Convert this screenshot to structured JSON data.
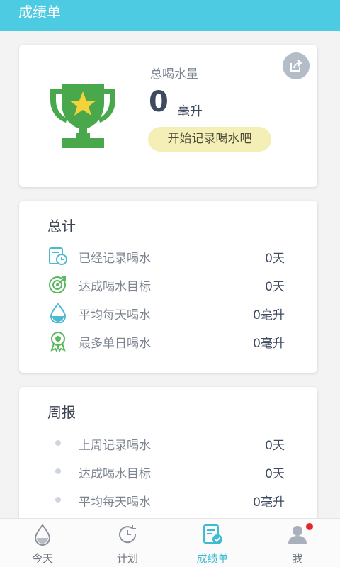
{
  "header": {
    "title": "成绩单"
  },
  "summary": {
    "total_label": "总喝水量",
    "total_value": "0",
    "total_unit": "毫升",
    "start_button": "开始记录喝水吧",
    "share_icon": "share-icon",
    "trophy_icon": "trophy-icon",
    "trophy_color": "#4aa84c",
    "star_color": "#f5d23a"
  },
  "totals": {
    "title": "总计",
    "rows": [
      {
        "icon": "calendar-clock-icon",
        "label": "已经记录喝水",
        "value": "0天"
      },
      {
        "icon": "target-icon",
        "label": "达成喝水目标",
        "value": "0天"
      },
      {
        "icon": "water-drop-icon",
        "label": "平均每天喝水",
        "value": "0毫升"
      },
      {
        "icon": "medal-icon",
        "label": "最多单日喝水",
        "value": "0毫升"
      }
    ]
  },
  "weekly": {
    "title": "周报",
    "rows": [
      {
        "label": "上周记录喝水",
        "value": "0天"
      },
      {
        "label": "达成喝水目标",
        "value": "0天"
      },
      {
        "label": "平均每天喝水",
        "value": "0毫升"
      }
    ]
  },
  "tabbar": {
    "tabs": [
      {
        "label": "今天",
        "icon": "water-drop-icon"
      },
      {
        "label": "计划",
        "icon": "history-clock-icon"
      },
      {
        "label": "成绩单",
        "icon": "report-icon",
        "active": true
      },
      {
        "label": "我",
        "icon": "user-icon"
      }
    ],
    "accent": "#3fbad3"
  }
}
